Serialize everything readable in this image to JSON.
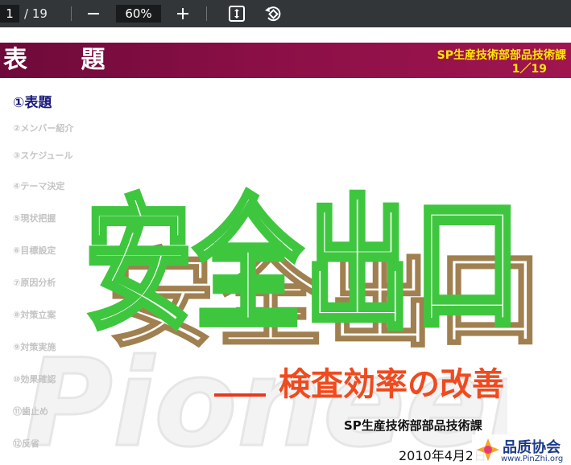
{
  "toolbar": {
    "page_current": "1",
    "page_total": "/ 19",
    "zoom": "60%",
    "icons": [
      "minus-icon",
      "plus-icon",
      "fit-page-icon",
      "rotate-icon"
    ]
  },
  "slide": {
    "banner_title": "表 題",
    "banner_dept": "SP生産技術部部品技術課",
    "banner_page": "1／19",
    "menu": [
      "①表題",
      "②メンバー紹介",
      "③スケジュール",
      "④テーマ決定",
      "⑤現状把握",
      "⑥目標設定",
      "⑦原因分析",
      "⑧対策立案",
      "⑨対策実施",
      "⑩効果確認",
      "⑪歯止め",
      "⑫反省"
    ],
    "main_title": "安全出口",
    "subtitle": "検査効率の改善",
    "dept_footer": "SP生産技術部部品技術課",
    "date": "2010年4月2日",
    "watermark": "Pioneer",
    "logo_text": "品质协会",
    "logo_url": "www.PinZhi.org",
    "colors": {
      "banner": "#8a0f46",
      "banner_text": "#ffe600",
      "outline_green": "#3fc63f",
      "outline_shadow": "#a08050",
      "subtitle": "#f04a1e",
      "menu_active": "#1a1a7a"
    }
  }
}
